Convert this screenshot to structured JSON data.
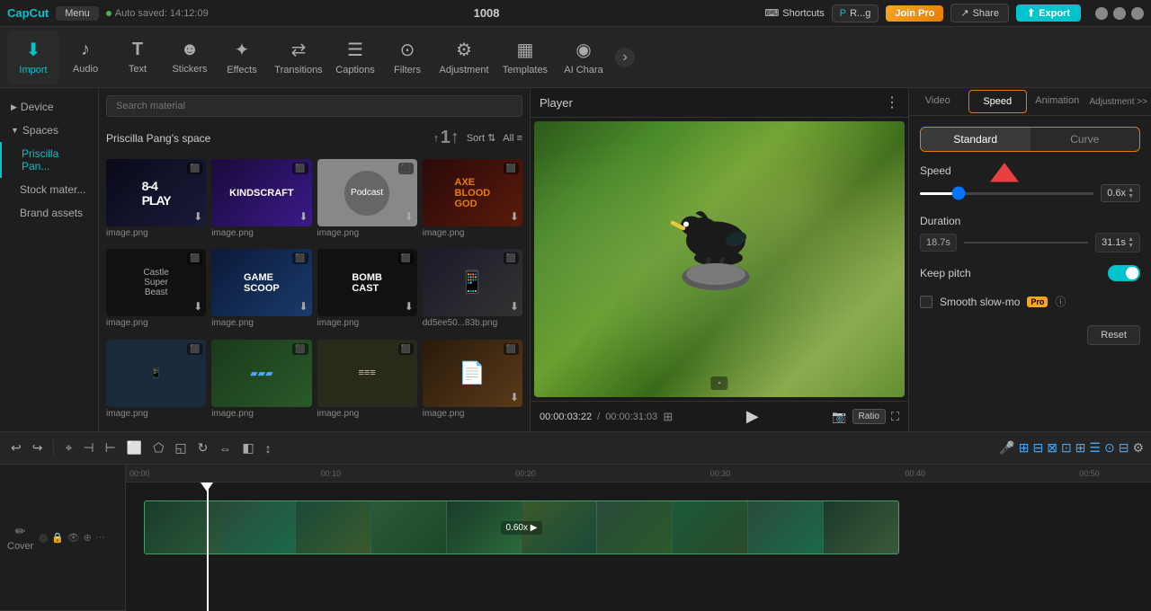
{
  "app": {
    "name": "CapCut",
    "menu_label": "Menu",
    "autosave": "Auto saved: 14:12:09",
    "project_id": "1008"
  },
  "topbar": {
    "shortcuts_label": "Shortcuts",
    "rang_label": "R...g",
    "joinpro_label": "Join Pro",
    "share_label": "Share",
    "export_label": "Export"
  },
  "toolbar": {
    "items": [
      {
        "id": "import",
        "label": "Import",
        "icon": "⬇"
      },
      {
        "id": "audio",
        "label": "Audio",
        "icon": "♪"
      },
      {
        "id": "text",
        "label": "Text",
        "icon": "T"
      },
      {
        "id": "stickers",
        "label": "Stickers",
        "icon": "☺"
      },
      {
        "id": "effects",
        "label": "Effects",
        "icon": "✦"
      },
      {
        "id": "transitions",
        "label": "Transitions",
        "icon": "⇄"
      },
      {
        "id": "captions",
        "label": "Captions",
        "icon": "☰"
      },
      {
        "id": "filters",
        "label": "Filters",
        "icon": "⊙"
      },
      {
        "id": "adjustment",
        "label": "Adjustment",
        "icon": "⚙"
      },
      {
        "id": "templates",
        "label": "Templates",
        "icon": "▦"
      },
      {
        "id": "ai_chara",
        "label": "AI Chara",
        "icon": "◉"
      }
    ],
    "more_icon": "›"
  },
  "sidebar": {
    "sections": [
      {
        "id": "device",
        "label": "Device",
        "type": "section"
      },
      {
        "id": "spaces",
        "label": "Spaces",
        "type": "section"
      },
      {
        "id": "priscilla",
        "label": "Priscilla Pan...",
        "type": "item",
        "selected": true
      },
      {
        "id": "stock",
        "label": "Stock mater...",
        "type": "item"
      },
      {
        "id": "brand",
        "label": "Brand assets",
        "type": "item"
      }
    ]
  },
  "media": {
    "search_placeholder": "Search material",
    "space_label": "Priscilla Pang's space",
    "sort_label": "Sort",
    "all_label": "All",
    "upload_icon": "⬆",
    "items": [
      {
        "filename": "image.png",
        "thumb_type": "8-4"
      },
      {
        "filename": "image.png",
        "thumb_type": "game"
      },
      {
        "filename": "image.png",
        "thumb_type": "podcast"
      },
      {
        "filename": "image.png",
        "thumb_type": "axe"
      },
      {
        "filename": "image.png",
        "thumb_type": "castle"
      },
      {
        "filename": "image.png",
        "thumb_type": "gamescoop"
      },
      {
        "filename": "image.png",
        "thumb_type": "bomb"
      },
      {
        "filename": "dd5ee50...83b.png",
        "thumb_type": "phone"
      },
      {
        "filename": "image.png",
        "thumb_type": "phone2"
      },
      {
        "filename": "image.png",
        "thumb_type": "green"
      },
      {
        "filename": "image.png",
        "thumb_type": "paper"
      }
    ]
  },
  "player": {
    "title": "Player",
    "time_current": "00:00:03:22",
    "time_total": "00:00:31:03",
    "ratio_label": "Ratio"
  },
  "right_panel": {
    "tabs": [
      {
        "id": "video",
        "label": "Video"
      },
      {
        "id": "speed",
        "label": "Speed",
        "active": true,
        "highlighted": true
      },
      {
        "id": "animation",
        "label": "Animation"
      },
      {
        "id": "adjustment",
        "label": "Adjustment >>"
      }
    ],
    "speed": {
      "mode_standard": "Standard",
      "mode_curve": "Curve",
      "speed_label": "Speed",
      "speed_value": "0.6x",
      "duration_label": "Duration",
      "duration_from": "18.7s",
      "duration_to": "31.1s",
      "keep_pitch_label": "Keep pitch",
      "smooth_slowmo_label": "Smooth slow-mo",
      "pro_badge": "Pro",
      "reset_label": "Reset"
    }
  },
  "timeline": {
    "ruler_marks": [
      "00:00",
      "00:10",
      "00:20",
      "00:30",
      "00:40",
      "00:50"
    ],
    "clip_label": "0.60x ▶",
    "cover_label": "Cover",
    "track_icons": [
      "◎",
      "🔒",
      "👁",
      "⊕",
      "···"
    ]
  }
}
